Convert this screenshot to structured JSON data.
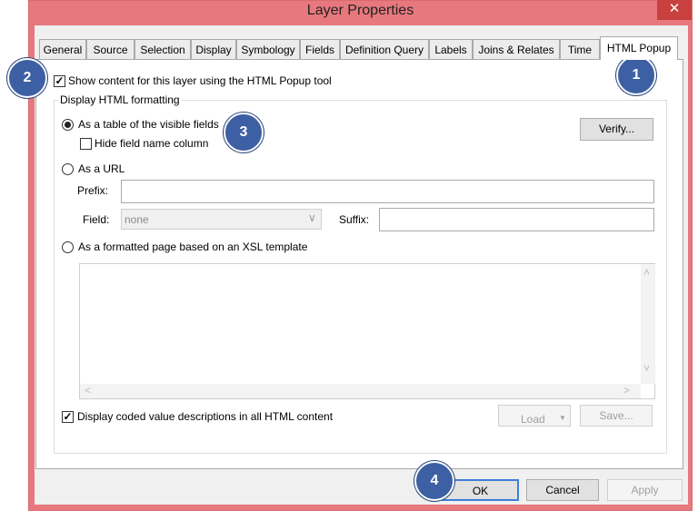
{
  "window": {
    "title": "Layer Properties",
    "close_glyph": "✕"
  },
  "tabs": [
    "General",
    "Source",
    "Selection",
    "Display",
    "Symbology",
    "Fields",
    "Definition Query",
    "Labels",
    "Joins & Relates",
    "Time",
    "HTML Popup"
  ],
  "active_tab": "HTML Popup",
  "show_content": {
    "label": "Show content for this layer using the HTML Popup tool",
    "checked": true
  },
  "group": {
    "label": "Display HTML formatting"
  },
  "option_table": {
    "label": "As a table of the visible fields",
    "selected": true
  },
  "hide_field": {
    "label": "Hide field name column",
    "checked": false
  },
  "verify_button": "Verify...",
  "option_url": {
    "label": "As a URL",
    "selected": false
  },
  "prefix": {
    "label": "Prefix:",
    "value": ""
  },
  "field": {
    "label": "Field:",
    "value": "none"
  },
  "suffix": {
    "label": "Suffix:",
    "value": ""
  },
  "option_xsl": {
    "label": "As a formatted page based on an XSL template",
    "selected": false
  },
  "coded_values": {
    "label": "Display coded value descriptions in all HTML content",
    "checked": true
  },
  "load_button": "Load",
  "save_button": "Save...",
  "footer": {
    "ok": "OK",
    "cancel": "Cancel",
    "apply": "Apply"
  },
  "callouts": [
    "1",
    "2",
    "3",
    "4"
  ],
  "colors": {
    "frame": "#e7787d",
    "badge": "#3d5fa3",
    "close": "#c8413f"
  }
}
